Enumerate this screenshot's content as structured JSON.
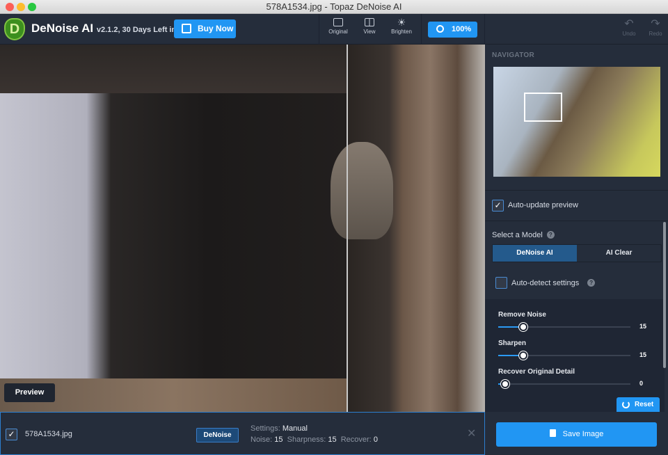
{
  "window": {
    "title": "578A1534.jpg - Topaz DeNoise AI"
  },
  "toolbar": {
    "logo_letter": "D",
    "app_name": "DeNoise AI",
    "app_version": "v2.1.2, 30 Days Left in Trial",
    "buy_now": "Buy Now",
    "original": "Original",
    "view": "View",
    "brighten": "Brighten",
    "zoom": "100%",
    "undo": "Undo",
    "redo": "Redo"
  },
  "image": {
    "preview_label": "Preview"
  },
  "panel": {
    "navigator": "NAVIGATOR",
    "auto_update": "Auto-update preview",
    "auto_update_checked": true,
    "select_model": "Select a Model",
    "models": [
      "DeNoise AI",
      "AI Clear"
    ],
    "selected_model": "DeNoise AI",
    "auto_detect": "Auto-detect settings",
    "auto_detect_checked": false,
    "sliders": [
      {
        "label": "Remove Noise",
        "value": "15",
        "fraction": 0.19
      },
      {
        "label": "Sharpen",
        "value": "15",
        "fraction": 0.19
      },
      {
        "label": "Recover Original Detail",
        "value": "0",
        "fraction": 0.05
      }
    ],
    "reset": "Reset"
  },
  "bottom": {
    "file_checked": true,
    "filename": "578A1534.jpg",
    "mode_badge": "DeNoise",
    "settings_label": "Settings:",
    "settings_value": "Manual",
    "noise_label": "Noise:",
    "noise_value": "15",
    "sharpness_label": "Sharpness:",
    "sharpness_value": "15",
    "recover_label": "Recover:",
    "recover_value": "0",
    "save": "Save Image"
  },
  "colors": {
    "accent": "#2196f3",
    "toolbar_bg": "#252d3b",
    "selected_model_bg": "#245a8c"
  }
}
